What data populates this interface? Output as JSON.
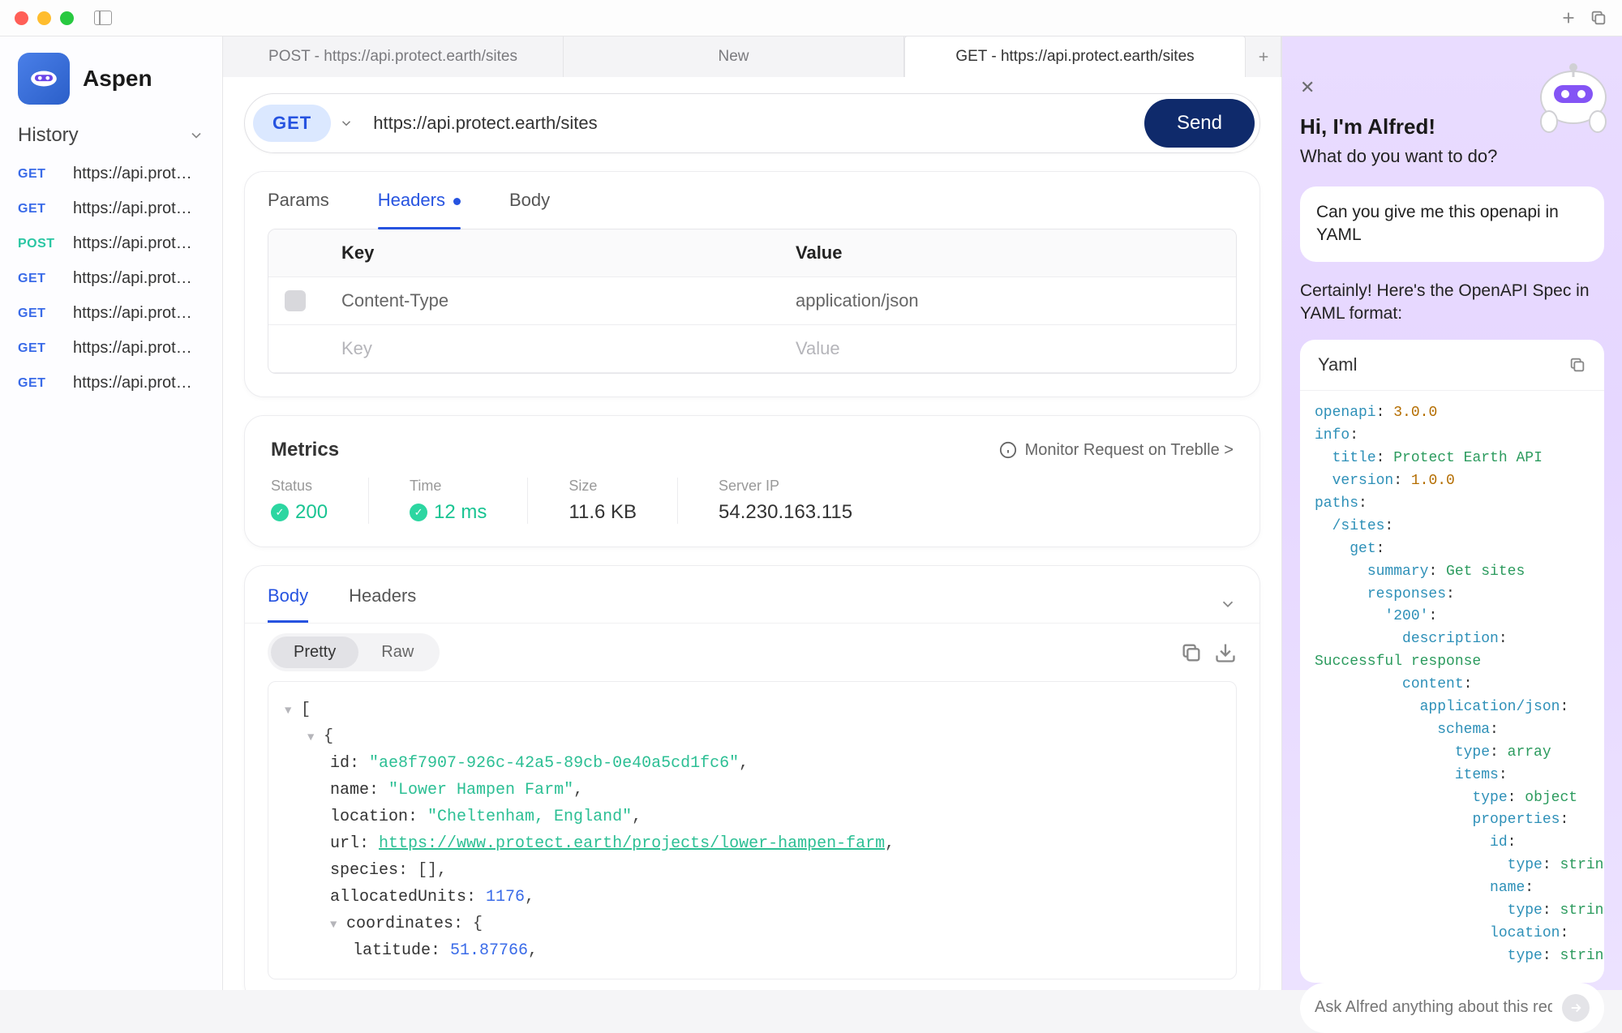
{
  "app_name": "Aspen",
  "titlebar": {
    "panel_icon": "panel-icon"
  },
  "sidebar": {
    "history_label": "History",
    "items": [
      {
        "method": "GET",
        "url": "https://api.prot…"
      },
      {
        "method": "GET",
        "url": "https://api.prot…"
      },
      {
        "method": "POST",
        "url": "https://api.prot…"
      },
      {
        "method": "GET",
        "url": "https://api.prot…"
      },
      {
        "method": "GET",
        "url": "https://api.prot…"
      },
      {
        "method": "GET",
        "url": "https://api.prot…"
      },
      {
        "method": "GET",
        "url": "https://api.prot…"
      }
    ]
  },
  "tabs": [
    {
      "label": "POST - https://api.protect.earth/sites",
      "active": false
    },
    {
      "label": "New",
      "active": false
    },
    {
      "label": "GET - https://api.protect.earth/sites",
      "active": true
    }
  ],
  "request": {
    "method": "GET",
    "url": "https://api.protect.earth/sites",
    "send_label": "Send",
    "tabs": {
      "params": "Params",
      "headers": "Headers",
      "body": "Body"
    },
    "headers_table": {
      "cols": {
        "key": "Key",
        "value": "Value"
      },
      "rows": [
        {
          "key": "Content-Type",
          "value": "application/json"
        }
      ],
      "placeholder_key": "Key",
      "placeholder_value": "Value"
    }
  },
  "metrics": {
    "title": "Metrics",
    "monitor": "Monitor Request on Treblle >",
    "status_label": "Status",
    "status_value": "200",
    "time_label": "Time",
    "time_value": "12 ms",
    "size_label": "Size",
    "size_value": "11.6 KB",
    "ip_label": "Server IP",
    "ip_value": "54.230.163.115"
  },
  "response": {
    "tabs": {
      "body": "Body",
      "headers": "Headers"
    },
    "view": {
      "pretty": "Pretty",
      "raw": "Raw"
    },
    "json": {
      "id": "\"ae8f7907-926c-42a5-89cb-0e40a5cd1fc6\"",
      "name": "\"Lower Hampen Farm\"",
      "location": "\"Cheltenham, England\"",
      "url": "https://www.protect.earth/projects/lower-hampen-farm",
      "species": "[]",
      "allocatedUnits": "1176",
      "coord_lat": "51.87766"
    }
  },
  "ai": {
    "greeting_title": "Hi, I'm Alfred!",
    "greeting_sub": "What do you want to do?",
    "user_msg": "Can you give me this openapi in YAML",
    "reply": "Certainly! Here's the OpenAPI Spec in YAML format:",
    "yaml_title": "Yaml",
    "yaml": {
      "openapi": "3.0.0",
      "info_title": "Protect Earth API",
      "info_version": "1.0.0",
      "summary": "Get sites",
      "desc": "Successful response",
      "ct": "application/json",
      "schema_type": "array",
      "items_type": "object",
      "prop_type": "string"
    },
    "input_placeholder": "Ask Alfred anything about this request…"
  }
}
